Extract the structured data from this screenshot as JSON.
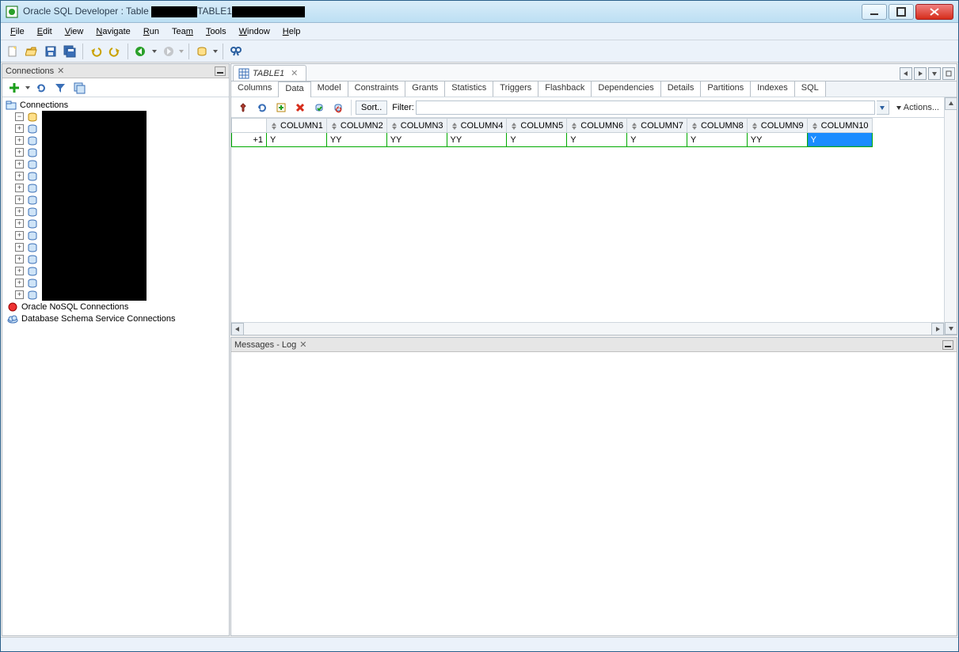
{
  "window": {
    "title_prefix": "Oracle SQL Developer : Table ",
    "title_mid": "TABLE1"
  },
  "menu": [
    "File",
    "Edit",
    "View",
    "Navigate",
    "Run",
    "Team",
    "Tools",
    "Window",
    "Help"
  ],
  "connections": {
    "title": "Connections",
    "root": "Connections",
    "nosql": "Oracle NoSQL Connections",
    "schema_svc": "Database Schema Service Connections",
    "hidden_count": 16
  },
  "editor": {
    "tab_label": "TABLE1",
    "subtabs": [
      "Columns",
      "Data",
      "Model",
      "Constraints",
      "Grants",
      "Statistics",
      "Triggers",
      "Flashback",
      "Dependencies",
      "Details",
      "Partitions",
      "Indexes",
      "SQL"
    ],
    "active_subtab": "Data",
    "sort_label": "Sort..",
    "filter_label": "Filter:",
    "filter_value": "",
    "actions_label": "Actions...",
    "columns": [
      "COLUMN1",
      "COLUMN2",
      "COLUMN3",
      "COLUMN4",
      "COLUMN5",
      "COLUMN6",
      "COLUMN7",
      "COLUMN8",
      "COLUMN9",
      "COLUMN10"
    ],
    "row": {
      "num": "+1",
      "cells": [
        "Y",
        "YY",
        "YY",
        "YY",
        "Y",
        "Y",
        "Y",
        "Y",
        "YY",
        "Y"
      ],
      "selected_col_index": 9
    }
  },
  "log": {
    "title": "Messages - Log"
  }
}
